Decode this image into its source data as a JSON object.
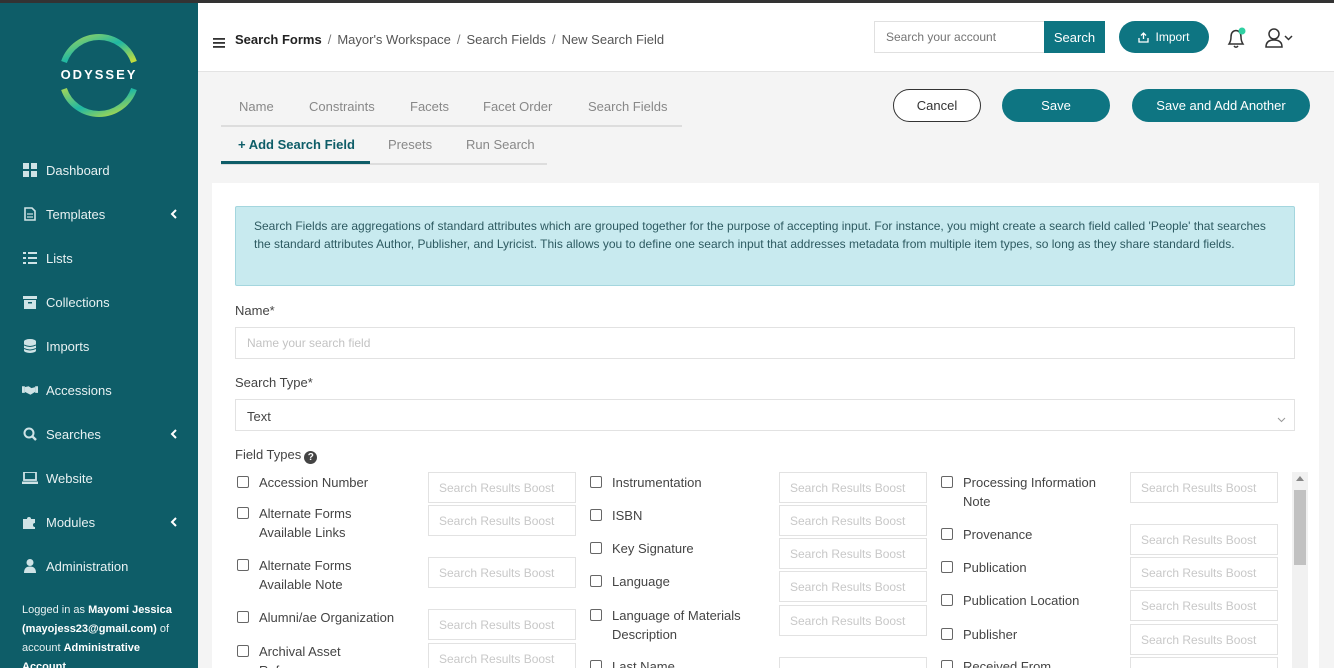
{
  "app": {
    "logo_text": "ODYSSEY"
  },
  "sidebar": {
    "items": [
      {
        "label": "Dashboard",
        "icon": "dashboard-icon",
        "has_submenu": false
      },
      {
        "label": "Templates",
        "icon": "file-icon",
        "has_submenu": true
      },
      {
        "label": "Lists",
        "icon": "list-icon",
        "has_submenu": false
      },
      {
        "label": "Collections",
        "icon": "archive-icon",
        "has_submenu": false
      },
      {
        "label": "Imports",
        "icon": "database-icon",
        "has_submenu": false
      },
      {
        "label": "Accessions",
        "icon": "handshake-icon",
        "has_submenu": false
      },
      {
        "label": "Searches",
        "icon": "search-icon",
        "has_submenu": true
      },
      {
        "label": "Website",
        "icon": "laptop-icon",
        "has_submenu": false
      },
      {
        "label": "Modules",
        "icon": "puzzle-icon",
        "has_submenu": true
      },
      {
        "label": "Administration",
        "icon": "user-icon",
        "has_submenu": false
      }
    ],
    "logged_in": {
      "prefix": "Logged in as",
      "name": "Mayomi Jessica",
      "email": "(mayojess23@gmail.com)",
      "account_prefix": "of account",
      "account": "Administrative Account"
    }
  },
  "header": {
    "breadcrumbs": [
      "Search Forms",
      "Mayor's Workspace",
      "Search Fields",
      "New Search Field"
    ],
    "search_placeholder": "Search your account",
    "search_button": "Search",
    "import_button": "Import"
  },
  "tabs_row1": [
    "Name",
    "Constraints",
    "Facets",
    "Facet Order",
    "Search Fields"
  ],
  "tabs_row2": [
    "+ Add Search Field",
    "Presets",
    "Run Search"
  ],
  "actions": {
    "cancel": "Cancel",
    "save": "Save",
    "save_add": "Save and Add Another"
  },
  "form": {
    "info_text": "Search Fields are aggregations of standard attributes which are grouped together for the purpose of accepting input. For instance, you might create a search field called 'People' that searches the standard attributes Author, Publisher, and Lyricist. This allows you to define one search input that addresses metadata from multiple item types, so long as they share standard fields.",
    "name_label": "Name*",
    "name_placeholder": "Name your search field",
    "search_type_label": "Search Type*",
    "search_type_value": "Text",
    "field_types_label": "Field Types",
    "boost_placeholder": "Search Results Boost",
    "field_types": [
      [
        "Accession Number",
        "Alternate Forms Available Links",
        "Alternate Forms Available Note",
        "Alumni/ae Organization",
        "Archival Asset Reference"
      ],
      [
        "Instrumentation",
        "ISBN",
        "Key Signature",
        "Language",
        "Language of Materials Description",
        "Last Name"
      ],
      [
        "Processing Information Note",
        "Provenance",
        "Publication",
        "Publication Location",
        "Publisher",
        "Received From"
      ]
    ]
  },
  "colors": {
    "sidebar": "#0e5d68",
    "accent": "#0e7582",
    "info_bg": "#c8eaef"
  }
}
